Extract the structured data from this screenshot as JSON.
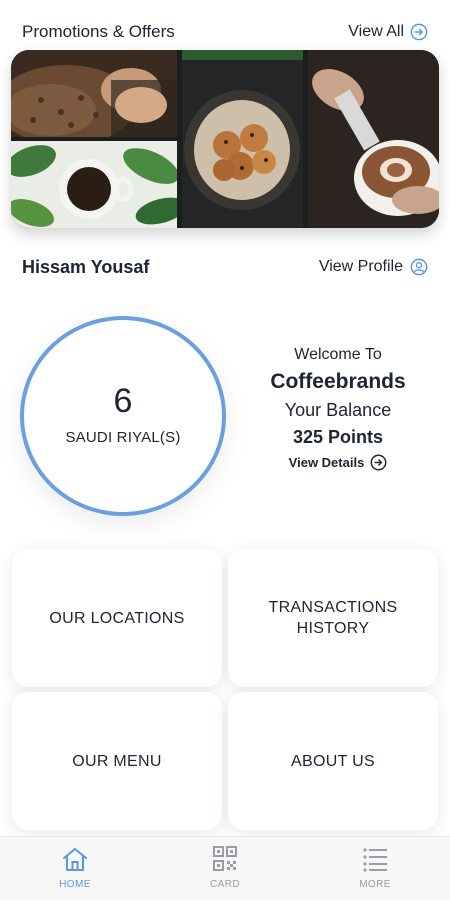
{
  "promotions": {
    "title": "Promotions & Offers",
    "view_all_label": "View All",
    "slides_total": 3,
    "active_slide": 1
  },
  "profile": {
    "name": "Hissam Yousaf",
    "view_profile_label": "View Profile"
  },
  "balance_ring": {
    "value": "6",
    "unit": "SAUDI RIYAL(S)"
  },
  "balance_info": {
    "welcome": "Welcome To",
    "brand": "Coffeebrands",
    "your_balance": "Your Balance",
    "points": "325 Points",
    "view_details_label": "View Details"
  },
  "menu_cards": {
    "locations": "OUR LOCATIONS",
    "transactions": "TRANSACTIONS HISTORY",
    "menu": "OUR MENU",
    "about": "ABOUT US"
  },
  "tabbar": {
    "home": "HOME",
    "card": "CARD",
    "more": "MORE",
    "active": "home"
  },
  "colors": {
    "accent": "#5b97de",
    "ring": "#6a9fe0",
    "text": "#1f2433",
    "inactive_tab": "#9a9ca3"
  },
  "icons": {
    "view_all": "arrow-circle-right-icon",
    "view_profile": "user-circle-icon",
    "view_details": "arrow-circle-right-icon",
    "home_tab": "home-icon",
    "card_tab": "qr-code-icon",
    "more_tab": "list-icon"
  }
}
